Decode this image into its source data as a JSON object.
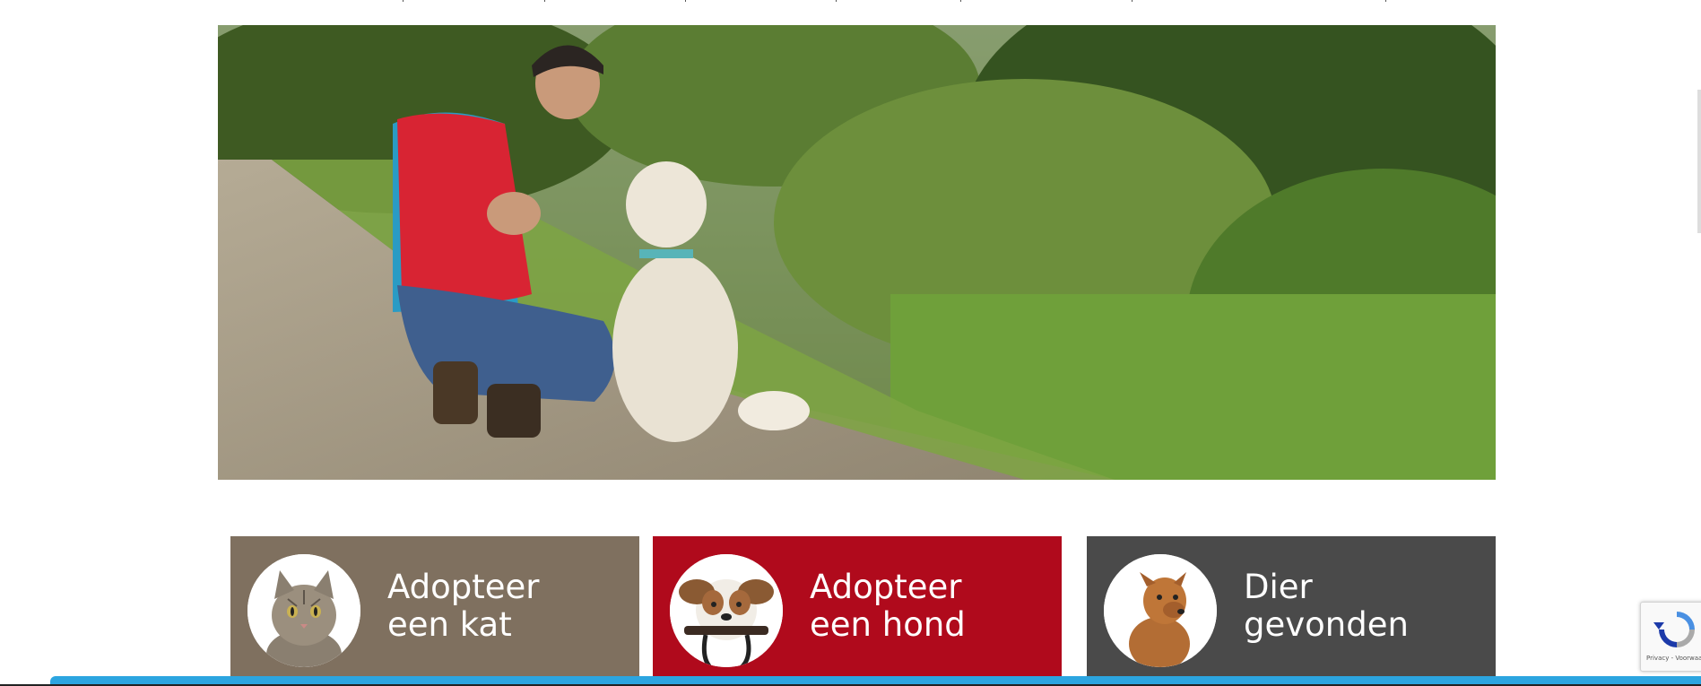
{
  "hero": {
    "image_alt": "Volunteer crouching with a dog on a lakeside path"
  },
  "cards": [
    {
      "line1": "Adopteer",
      "line2": "een kat",
      "color": "#7f705f",
      "icon": "cat-photo-icon"
    },
    {
      "line1": "Adopteer",
      "line2": "een hond",
      "color": "#b00a1c",
      "icon": "dog-with-leash-photo-icon"
    },
    {
      "line1": "Dier",
      "line2": "gevonden",
      "color": "#4a4a4a",
      "icon": "found-dog-photo-icon"
    }
  ],
  "recaptcha": {
    "links": "Privacy - Voorwaarden",
    "icon": "recaptcha-icon"
  },
  "colors": {
    "accent_bar": "#2ca5e0",
    "cat_card": "#7f705f",
    "dog_card": "#b00a1c",
    "found_card": "#4a4a4a"
  }
}
